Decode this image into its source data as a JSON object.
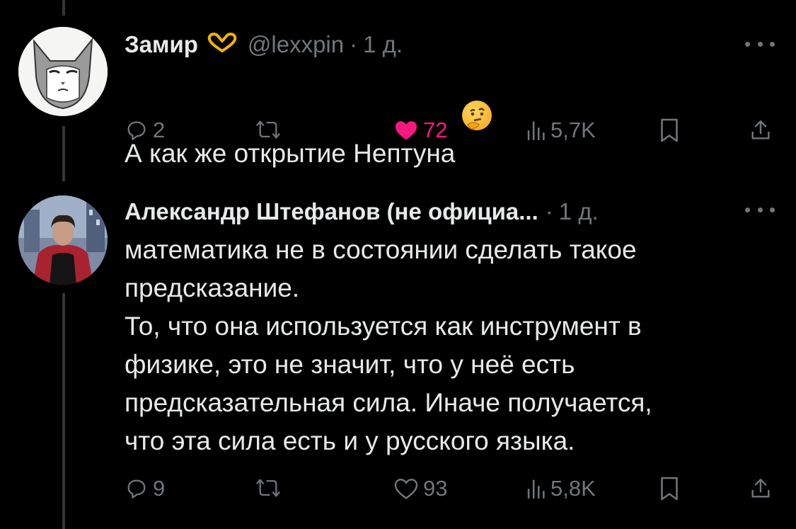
{
  "tweets": [
    {
      "author_name": "Замир",
      "badge_icon": "heart-hands-emoji",
      "handle": "@lexxpin",
      "separator": "·",
      "time": "1 д.",
      "text": "А как же открытие Нептуна",
      "emoji": "thinking-face-emoji",
      "replies": "2",
      "retweets": "",
      "likes": "72",
      "liked": true,
      "views": "5,7K"
    },
    {
      "author_name": "Александр Штефанов (не официа...",
      "handle": "",
      "separator": "·",
      "time": "1 д.",
      "text": "математика не в состоянии сделать такое\nпредсказание.\nТо, что она используется как инструмент в\nфизике, это не значит, что у неё есть\nпредсказательная сила. Иначе получается,\nчто эта сила есть и у русского языка.",
      "replies": "9",
      "retweets": "",
      "likes": "93",
      "liked": false,
      "views": "5,8K"
    }
  ],
  "colors": {
    "background": "#000000",
    "text": "#e7e9ea",
    "muted": "#71767b",
    "like": "#f91880"
  }
}
